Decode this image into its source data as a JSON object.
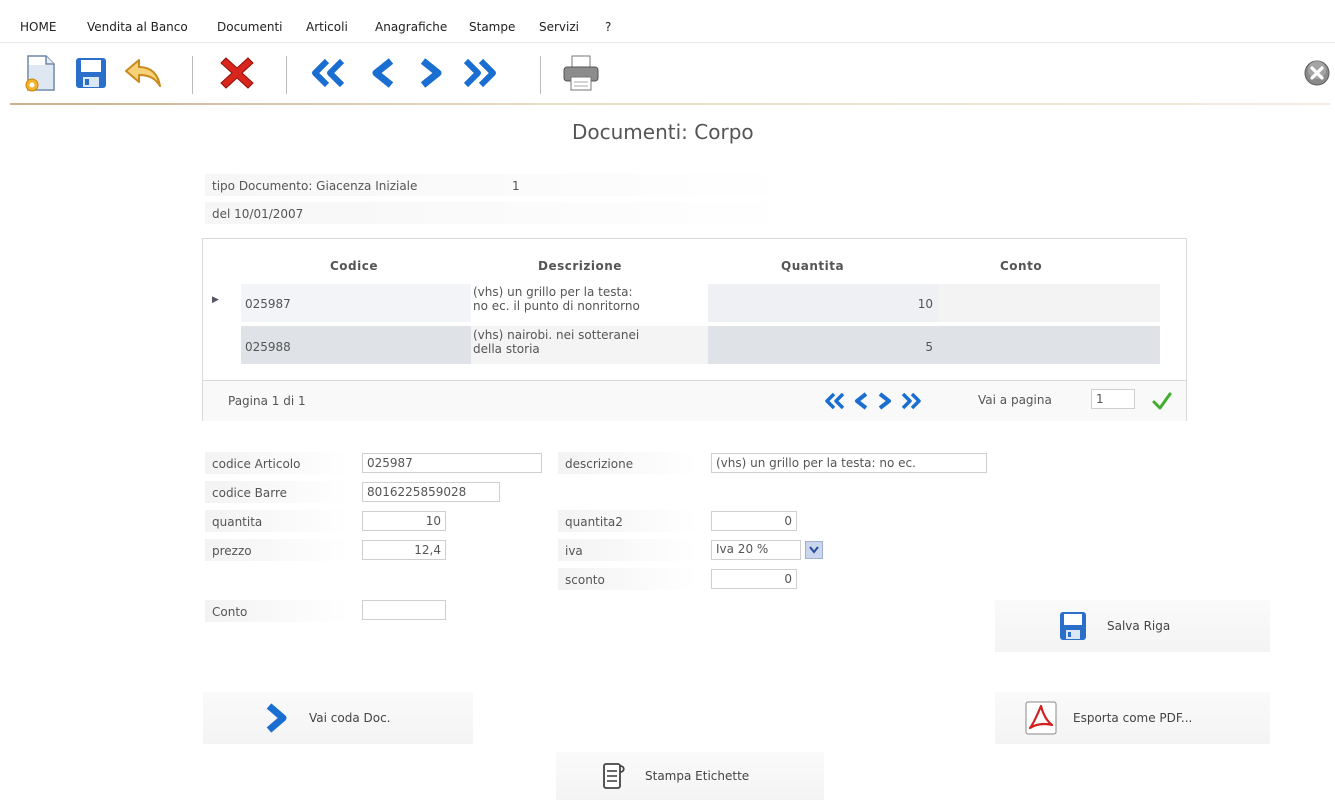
{
  "menu": [
    "HOME",
    "Vendita al Banco",
    "Documenti",
    "Articoli",
    "Anagrafiche",
    "Stampe",
    "Servizi",
    "?"
  ],
  "page_title": "Documenti: Corpo",
  "doc_info": {
    "tipo_label": "tipo Documento: Giacenza Iniziale",
    "tipo_value": "1",
    "date_label": "del 10/01/2007"
  },
  "grid": {
    "headers": [
      "Codice",
      "Descrizione",
      "Quantita",
      "Conto"
    ],
    "rows": [
      {
        "codice": "025987",
        "descr1": "(vhs) un grillo per la testa:",
        "descr2": "no ec. il punto di nonritorno",
        "quantita": "10",
        "conto": ""
      },
      {
        "codice": "025988",
        "descr1": "(vhs) nairobi. nei sotteranei",
        "descr2": "della storia",
        "quantita": "5",
        "conto": ""
      }
    ],
    "page_info": "Pagina 1 di 1",
    "goto_label": "Vai a pagina",
    "goto_value": "1"
  },
  "form": {
    "codice_articolo_label": "codice Articolo",
    "codice_articolo_value": "025987",
    "descrizione_label": "descrizione",
    "descrizione_value": "(vhs) un grillo per la testa: no ec.",
    "codice_barre_label": "codice Barre",
    "codice_barre_value": "8016225859028",
    "quantita_label": "quantita",
    "quantita_value": "10",
    "quantita2_label": "quantita2",
    "quantita2_value": "0",
    "prezzo_label": "prezzo",
    "prezzo_value": "12,4",
    "iva_label": "iva",
    "iva_value": "Iva 20 %",
    "sconto_label": "sconto",
    "sconto_value": "0",
    "conto_label": "Conto",
    "conto_value": ""
  },
  "actions": {
    "salva_riga": "Salva Riga",
    "vai_coda": "Vai coda Doc.",
    "esporta_pdf": "Esporta come PDF...",
    "stampa_etichette": "Stampa Etichette"
  },
  "colors": {
    "nav_blue": "#1b6ed1",
    "delete_red": "#d9261c",
    "check_green": "#3fae2a",
    "save_blue": "#2a6fc9"
  }
}
